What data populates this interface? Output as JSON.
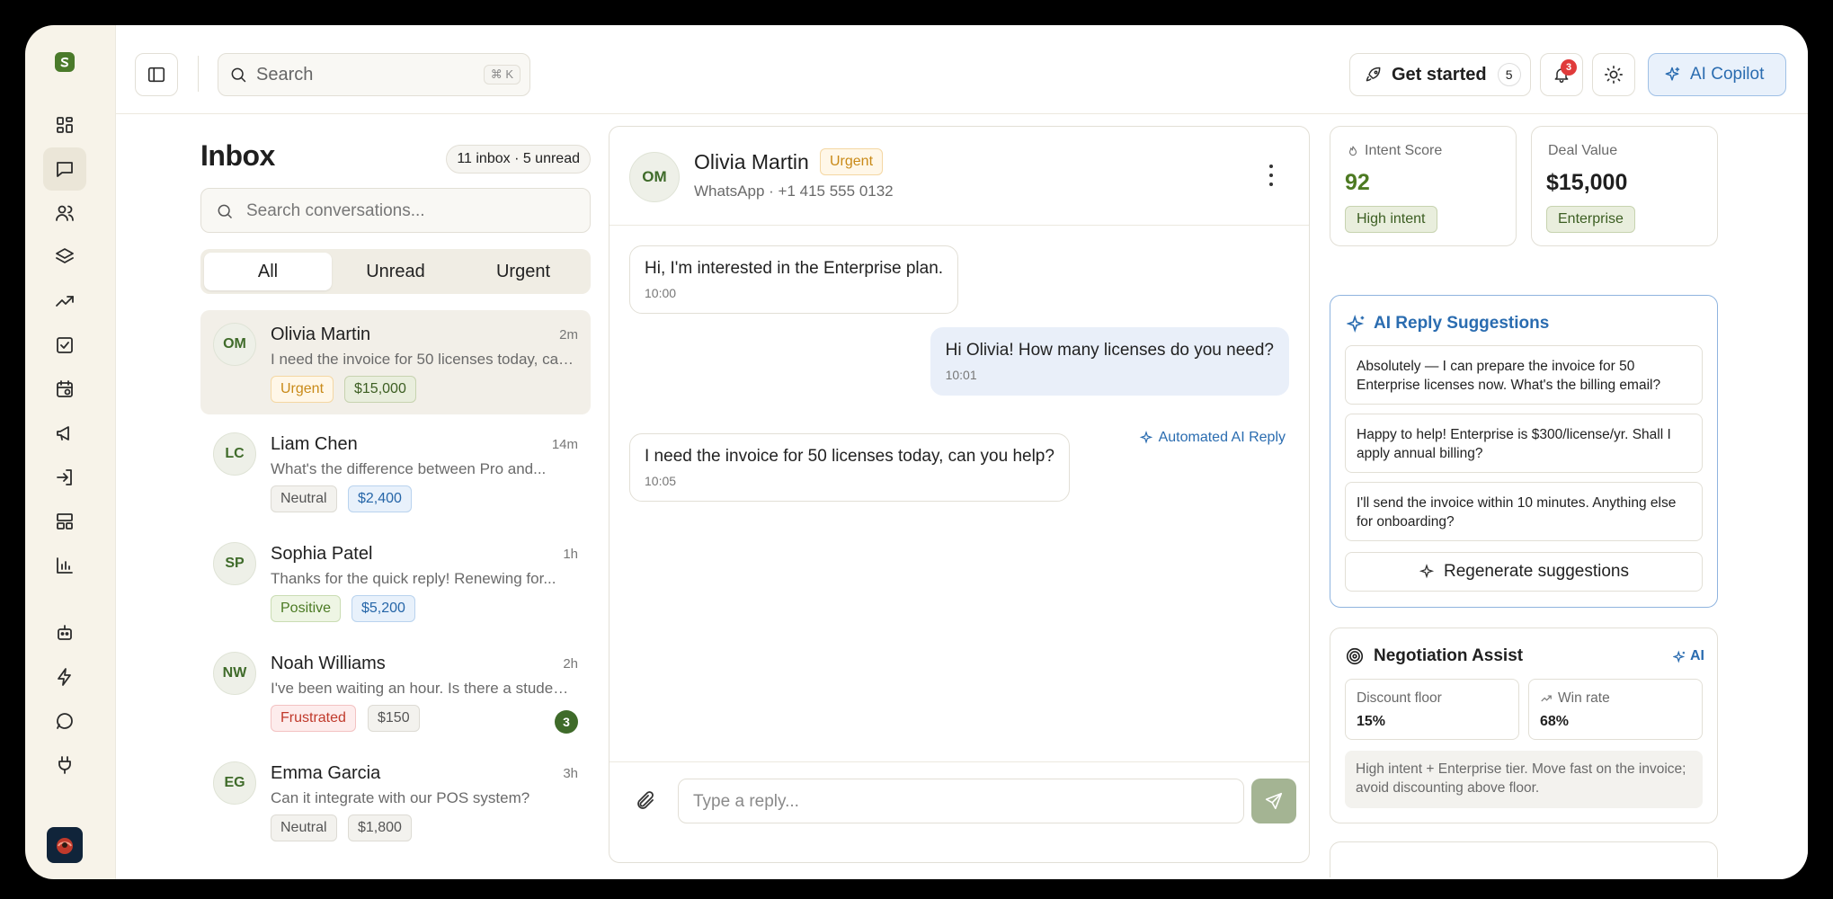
{
  "topbar": {
    "search_placeholder": "Search",
    "search_shortcut": "⌘ K",
    "get_started_label": "Get started",
    "get_started_count": "5",
    "notifications_count": "3",
    "copilot_label": "AI Copilot"
  },
  "inbox": {
    "title": "Inbox",
    "summary": "11 inbox · 5 unread",
    "search_placeholder": "Search conversations...",
    "tabs": [
      "All",
      "Unread",
      "Urgent"
    ],
    "conversations": [
      {
        "initials": "OM",
        "name": "Olivia Martin",
        "time": "2m",
        "preview": "I need the invoice for 50 licenses today, can...",
        "tags": [
          "Urgent",
          "$15,000"
        ]
      },
      {
        "initials": "LC",
        "name": "Liam Chen",
        "time": "14m",
        "preview": "What's the difference between Pro and...",
        "tags": [
          "Neutral",
          "$2,400"
        ]
      },
      {
        "initials": "SP",
        "name": "Sophia Patel",
        "time": "1h",
        "preview": "Thanks for the quick reply! Renewing for...",
        "tags": [
          "Positive",
          "$5,200"
        ]
      },
      {
        "initials": "NW",
        "name": "Noah Williams",
        "time": "2h",
        "preview": "I've been waiting an hour. Is there a student...",
        "tags": [
          "Frustrated",
          "$150"
        ],
        "unread": "3"
      },
      {
        "initials": "EG",
        "name": "Emma Garcia",
        "time": "3h",
        "preview": "Can it integrate with our POS system?",
        "tags": [
          "Neutral",
          "$1,800"
        ]
      }
    ]
  },
  "chat": {
    "initials": "OM",
    "name": "Olivia Martin",
    "status": "Urgent",
    "channel": "WhatsApp · +1 415 555 0132",
    "messages": [
      {
        "text": "Hi, I'm interested in the Enterprise plan.",
        "time": "10:00"
      },
      {
        "text": "Hi Olivia! How many licenses do you need?",
        "time": "10:01"
      },
      {
        "text": "I need the invoice for 50 licenses today, can you help?",
        "time": "10:05"
      }
    ],
    "automated_label": "Automated AI Reply",
    "reply_placeholder": "Type a reply..."
  },
  "insights": {
    "intent_label": "Intent Score",
    "intent_value": "92",
    "intent_pill": "High intent",
    "deal_label": "Deal Value",
    "deal_value": "$15,000",
    "deal_pill": "Enterprise"
  },
  "ai_suggestions": {
    "title": "AI Reply Suggestions",
    "items": [
      "Absolutely — I can prepare the invoice for 50 Enterprise licenses now. What's the billing email?",
      "Happy to help! Enterprise is $300/license/yr. Shall I apply annual billing?",
      "I'll send the invoice within 10 minutes. Anything else for onboarding?"
    ],
    "regenerate_label": "Regenerate suggestions"
  },
  "negotiation": {
    "title": "Negotiation Assist",
    "ai_label": "AI",
    "discount_label": "Discount floor",
    "discount_value": "15%",
    "winrate_label": "Win rate",
    "winrate_value": "68%",
    "note": "High intent + Enterprise tier. Move fast on the invoice; avoid discounting above floor."
  },
  "colors": {
    "brand_green": "#3f6b2a",
    "accent_blue": "#2a6cb0",
    "urgent_amber": "#c98a18",
    "danger_red": "#c0392b"
  },
  "icons": [
    "logo-icon",
    "dashboard-icon",
    "chat-icon",
    "users-icon",
    "layers-icon",
    "trending-icon",
    "tasks-icon",
    "calendar-icon",
    "megaphone-icon",
    "import-icon",
    "layout-icon",
    "bar-chart-icon",
    "bot-icon",
    "zap-icon",
    "message-circle-icon",
    "plug-icon"
  ]
}
